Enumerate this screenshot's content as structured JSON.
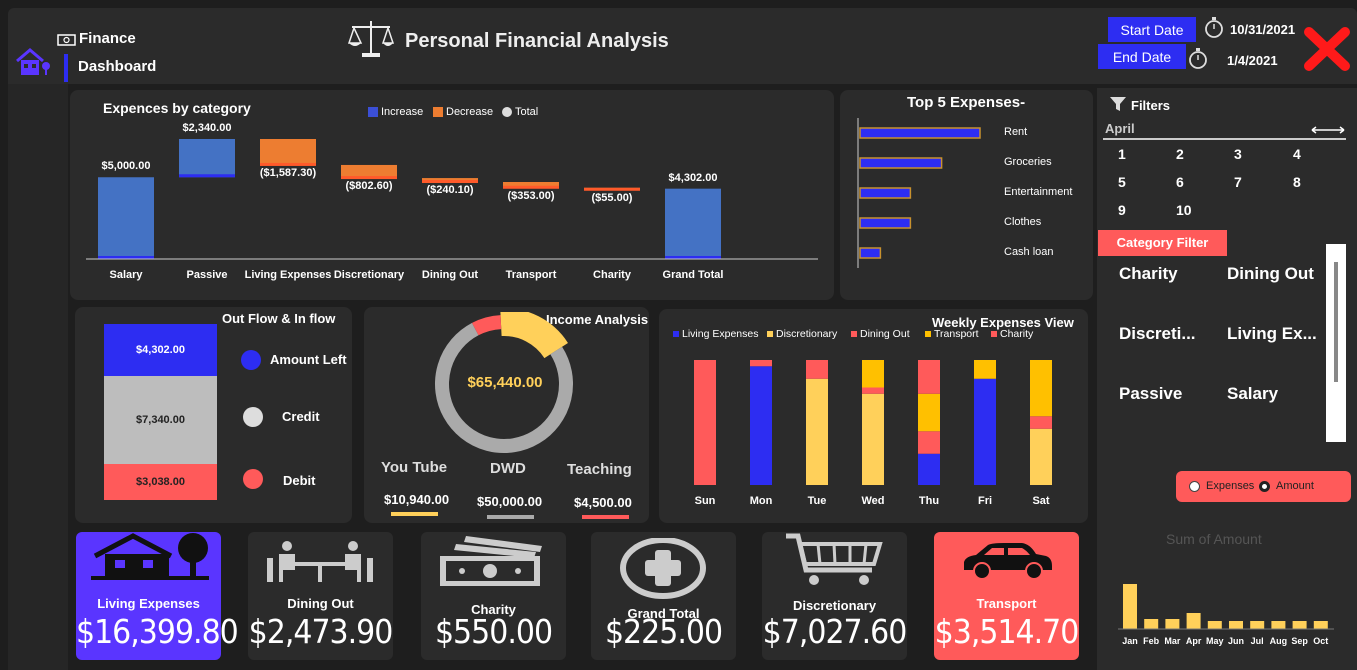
{
  "header": {
    "app_line1": "Finance",
    "app_line2": "Dashboard",
    "title": "Personal Financial Analysis",
    "start_label": "Start Date",
    "end_label": "End Date",
    "start_date": "10/31/2021",
    "end_date": "1/4/2021"
  },
  "waterfall": {
    "title": "Expences by category",
    "legend": [
      "Increase",
      "Decrease",
      "Total"
    ],
    "categories": [
      "Salary",
      "Passive",
      "Living Expenses",
      "Discretionary",
      "Dining Out",
      "Transport",
      "Charity",
      "Grand Total"
    ],
    "labels": [
      "$5,000.00",
      "$2,340.00",
      "($1,587.30)",
      "($802.60)",
      "($240.10)",
      "($353.00)",
      "($55.00)",
      "$4,302.00"
    ]
  },
  "top5": {
    "title": "Top 5 Expenses-",
    "items": [
      "Rent",
      "Groceries",
      "Entertainment",
      "Clothes",
      "Cash loan"
    ]
  },
  "filters": {
    "title": "Filters",
    "month": "April",
    "days": [
      "1",
      "2",
      "3",
      "4",
      "5",
      "6",
      "7",
      "8",
      "9",
      "10"
    ],
    "category_title": "Category Filter",
    "categories": [
      "Charity",
      "Dining Out",
      "Discreti...",
      "Living Ex...",
      "Passive",
      "Salary"
    ],
    "radio_expenses": "Expenses",
    "radio_amount": "Amount",
    "sum_title": "Sum of Amount"
  },
  "outflow": {
    "title": "Out Flow & In flow",
    "values": [
      "$4,302.00",
      "$7,340.00",
      "$3,038.00"
    ],
    "legend": [
      "Amount Left",
      "Credit",
      "Debit"
    ]
  },
  "income": {
    "title": "Income Analysis",
    "total": "$65,440.00",
    "sources": [
      "You Tube",
      "DWD",
      "Teaching"
    ],
    "amounts": [
      "$10,940.00",
      "$50,000.00",
      "$4,500.00"
    ]
  },
  "weekly": {
    "title": "Weekly Expenses View",
    "legend": [
      "Living Expenses",
      "Discretionary",
      "Dining Out",
      "Transport",
      "Charity"
    ],
    "days": [
      "Sun",
      "Mon",
      "Tue",
      "Wed",
      "Thu",
      "Fri",
      "Sat"
    ]
  },
  "cards": [
    {
      "label": "Living Expenses",
      "value": "$16,399.80"
    },
    {
      "label": "Dining Out",
      "value": "$2,473.90"
    },
    {
      "label": "Charity",
      "value": "$550.00"
    },
    {
      "label": "Grand Total",
      "value": "$225.00"
    },
    {
      "label": "Discretionary",
      "value": "$7,027.60"
    },
    {
      "label": "Transport",
      "value": "$3,514.70"
    }
  ],
  "colors": {
    "blue": "#2d2df2",
    "orange": "#ed7d31",
    "yellow": "#ffd05a",
    "red": "#ff5a5a",
    "purple": "#5a35ff",
    "grey": "#bdbdbd"
  },
  "chart_data": [
    {
      "type": "bar",
      "subtype": "waterfall",
      "title": "Expences by category",
      "categories": [
        "Salary",
        "Passive",
        "Living Expenses",
        "Discretionary",
        "Dining Out",
        "Transport",
        "Charity",
        "Grand Total"
      ],
      "values": [
        5000,
        2340,
        -1587.3,
        -802.6,
        -240.1,
        -353,
        -55,
        4302
      ],
      "legend": [
        "Increase",
        "Decrease",
        "Total"
      ]
    },
    {
      "type": "bar",
      "orientation": "horizontal",
      "title": "Top 5 Expenses-",
      "categories": [
        "Rent",
        "Groceries",
        "Entertainment",
        "Clothes",
        "Cash loan"
      ],
      "values": [
        100,
        68,
        42,
        42,
        17
      ]
    },
    {
      "type": "bar",
      "subtype": "stacked",
      "title": "Out Flow & In flow",
      "categories": [
        "Amount Left",
        "Credit",
        "Debit"
      ],
      "values": [
        4302,
        7340,
        3038
      ]
    },
    {
      "type": "pie",
      "subtype": "donut",
      "title": "Income Analysis",
      "categories": [
        "You Tube",
        "DWD",
        "Teaching"
      ],
      "values": [
        10940,
        50000,
        4500
      ],
      "center_label": "$65,440.00"
    },
    {
      "type": "bar",
      "subtype": "stacked_percent",
      "title": "Weekly Expenses View",
      "categories": [
        "Sun",
        "Mon",
        "Tue",
        "Wed",
        "Thu",
        "Fri",
        "Sat"
      ],
      "series": [
        {
          "name": "Living Expenses",
          "values": [
            0,
            95,
            0,
            0,
            25,
            85,
            0
          ]
        },
        {
          "name": "Discretionary",
          "values": [
            0,
            0,
            85,
            73,
            0,
            0,
            45
          ]
        },
        {
          "name": "Dining Out",
          "values": [
            100,
            5,
            15,
            5,
            18,
            0,
            10
          ]
        },
        {
          "name": "Transport",
          "values": [
            0,
            0,
            0,
            22,
            30,
            15,
            45
          ]
        },
        {
          "name": "Charity",
          "values": [
            0,
            0,
            0,
            0,
            27,
            0,
            0
          ]
        }
      ]
    },
    {
      "type": "bar",
      "title": "Sum of Amount",
      "categories": [
        "Jan",
        "Feb",
        "Mar",
        "Apr",
        "May",
        "Jun",
        "Jul",
        "Aug",
        "Sep",
        "Oct"
      ],
      "values": [
        45,
        10,
        10,
        16,
        8,
        8,
        8,
        8,
        8,
        8
      ]
    }
  ]
}
